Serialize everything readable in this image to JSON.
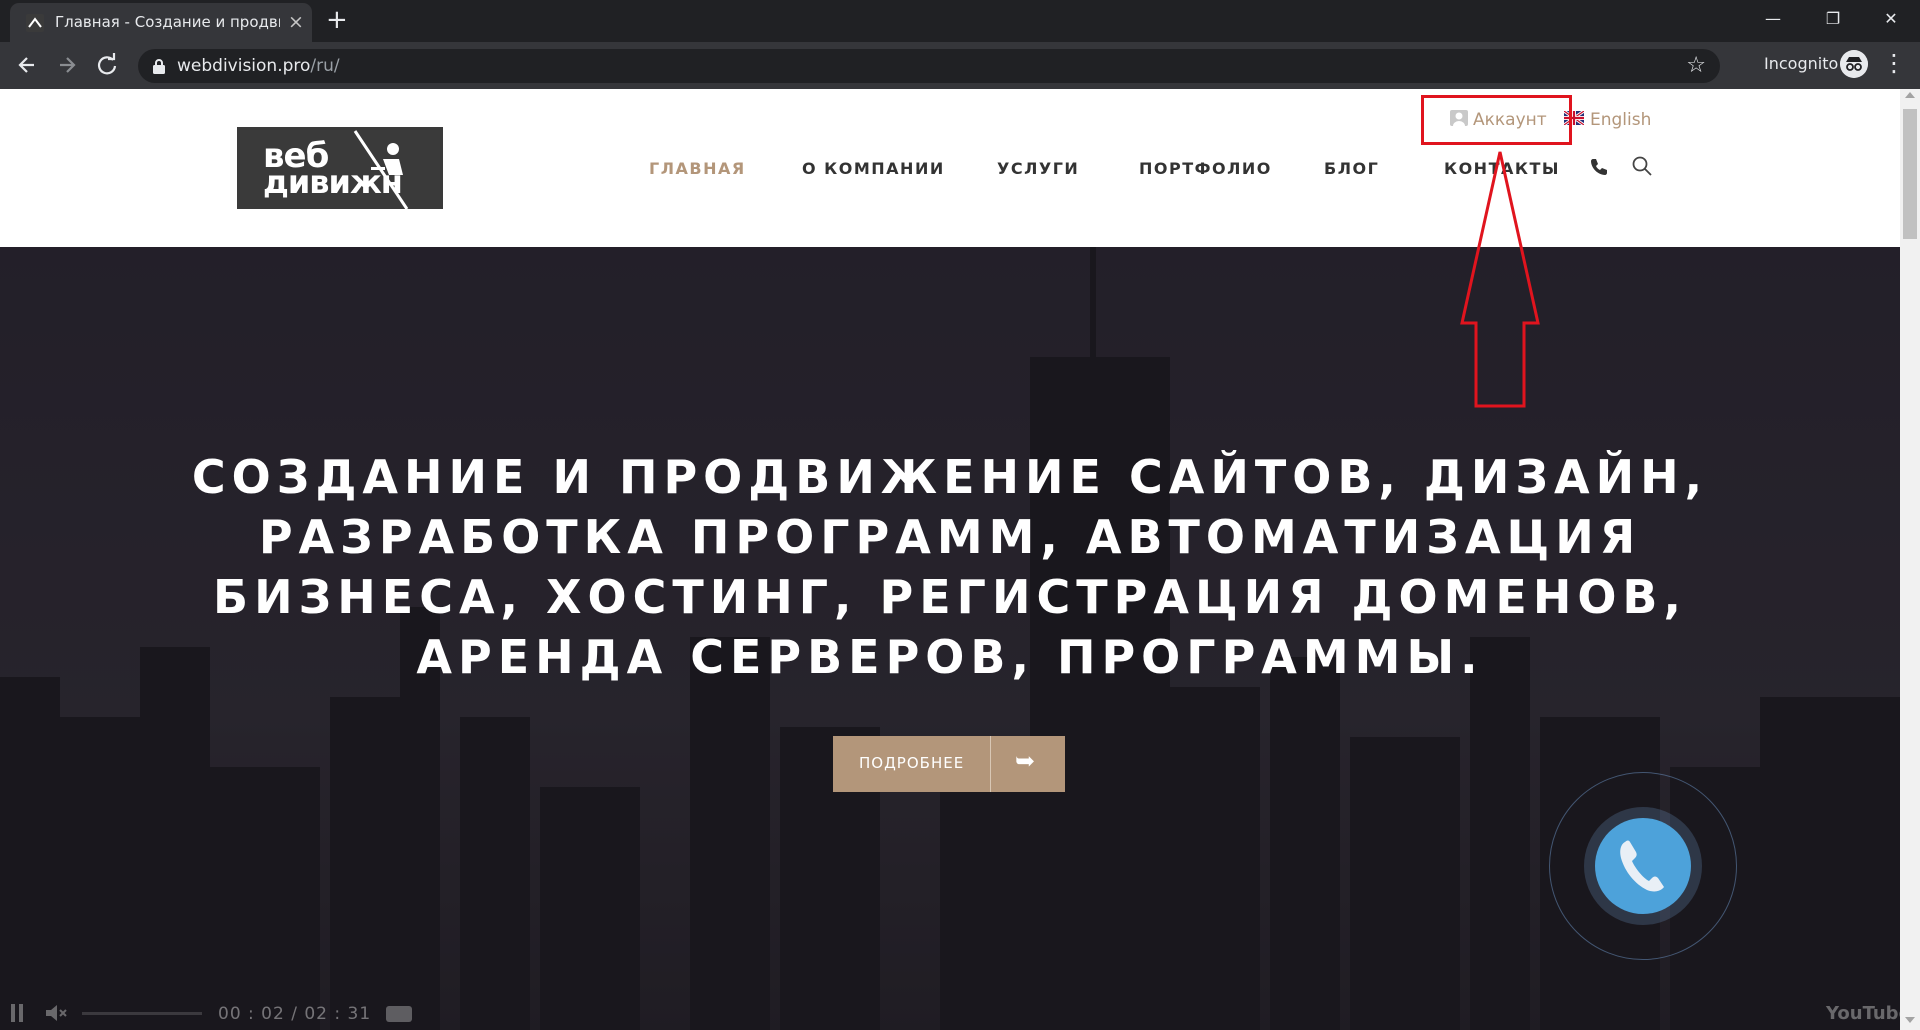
{
  "browser": {
    "tab_title": "Главная - Создание и продвижение",
    "tab_close": "×",
    "new_tab": "+",
    "url_host": "webdivision.pro",
    "url_path": "/ru/",
    "incognito_label": "Incognito",
    "window_minimize": "—",
    "window_restore": "❐",
    "window_close": "✕"
  },
  "header": {
    "logo_line1": "веб",
    "logo_line2": "дивижн",
    "account_label": "Аккаунт",
    "language_label": "English",
    "nav": [
      {
        "label": "ГЛАВНАЯ",
        "active": true
      },
      {
        "label": "О КОМПАНИИ",
        "active": false
      },
      {
        "label": "УСЛУГИ",
        "active": false
      },
      {
        "label": "ПОРТФОЛИО",
        "active": false
      },
      {
        "label": "БЛОГ",
        "active": false
      },
      {
        "label": "КОНТАКТЫ",
        "active": false
      }
    ]
  },
  "hero": {
    "title": "СОЗДАНИЕ И ПРОДВИЖЕНИЕ САЙТОВ, ДИЗАЙН, РАЗРАБОТКА ПРОГРАММ, АВТОМАТИЗАЦИЯ БИЗНЕСА, ХОСТИНГ, РЕГИСТРАЦИЯ ДОМЕНОВ, АРЕНДА СЕРВЕРОВ, ПРОГРАММЫ.",
    "button_label": "ПОДРОБНЕЕ",
    "video_time": "00 : 02 / 02 : 31",
    "video_brand": "YouTube"
  },
  "colors": {
    "accent": "#b3967a",
    "annotation": "#e0141e",
    "call_button": "#4da2da"
  },
  "icons": [
    "back-icon",
    "forward-icon",
    "reload-icon",
    "lock-icon",
    "star-icon",
    "incognito-icon",
    "user-icon",
    "uk-flag-icon",
    "phone-icon",
    "search-icon",
    "arrow-right-icon",
    "handset-icon",
    "pause-icon",
    "mute-icon"
  ]
}
